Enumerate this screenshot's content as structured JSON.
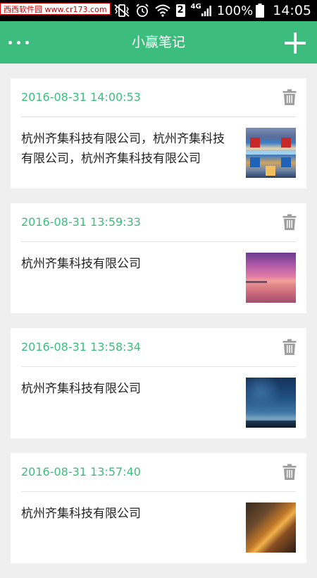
{
  "status_bar": {
    "watermark": "西西软件园 www.cr173.com",
    "sim_slot": "2",
    "network": "4G",
    "battery_percent": "100%",
    "time": "14:05"
  },
  "app_bar": {
    "title": "小赢笔记",
    "menu_icon": "more-dots-icon",
    "add_icon": "plus-icon"
  },
  "notes": [
    {
      "date": "2016-08-31 14:00:53",
      "text": "杭州齐集科技有限公司，杭州齐集科技有限公司，杭州齐集科技有限公司",
      "thumbnail": "game-screenshot"
    },
    {
      "date": "2016-08-31 13:59:33",
      "text": "杭州齐集科技有限公司",
      "thumbnail": "pink-sunset"
    },
    {
      "date": "2016-08-31 13:58:34",
      "text": "杭州齐集科技有限公司",
      "thumbnail": "night-sky"
    },
    {
      "date": "2016-08-31 13:57:40",
      "text": "杭州齐集科技有限公司",
      "thumbnail": "orange-scene"
    }
  ],
  "colors": {
    "accent": "#3dbd7d",
    "background": "#efefef",
    "card": "#ffffff",
    "delete_icon": "#9e9e9e"
  }
}
